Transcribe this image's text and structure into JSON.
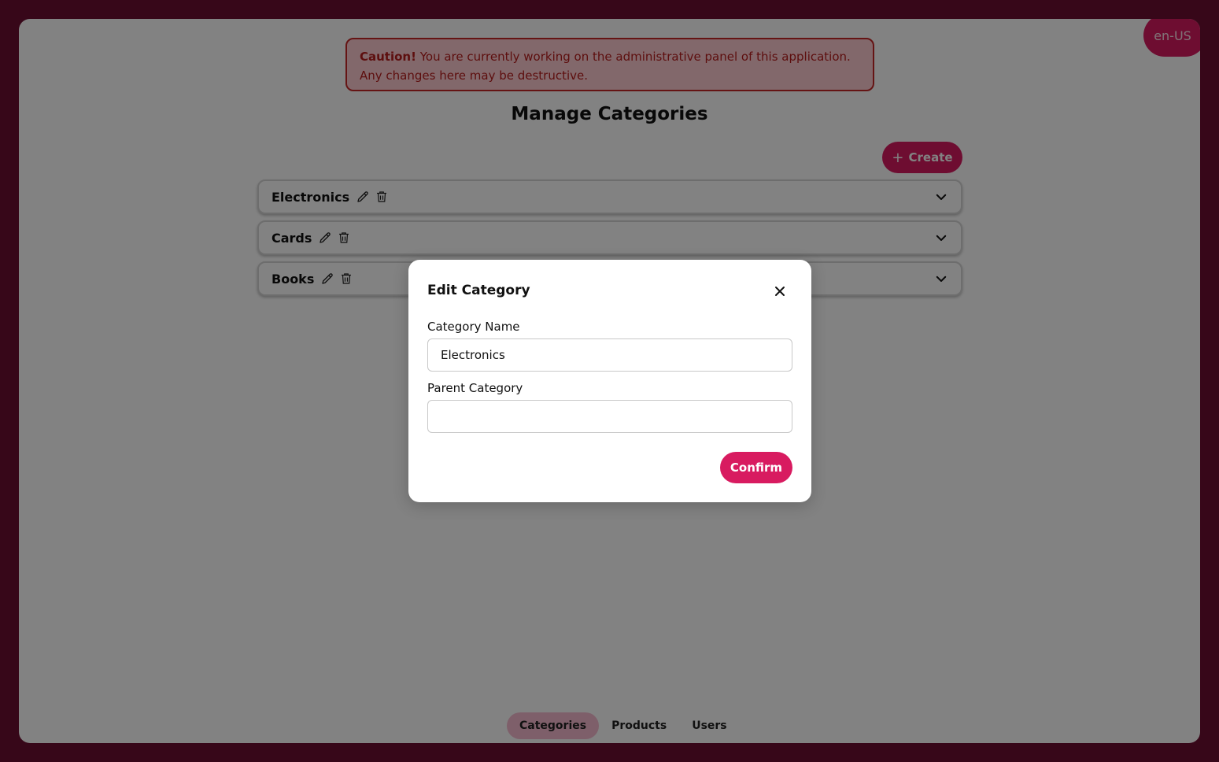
{
  "locale": {
    "label": "en-US"
  },
  "caution": {
    "title": "Caution!",
    "message": " You are currently working on the administrative panel of this application. Any changes here may be destructive."
  },
  "page": {
    "title": "Manage Categories"
  },
  "toolbar": {
    "create_label": "Create",
    "create_icon": "plus-icon"
  },
  "categories": [
    {
      "name": "Electronics"
    },
    {
      "name": "Cards"
    },
    {
      "name": "Books"
    }
  ],
  "nav": {
    "tabs": [
      {
        "label": "Categories",
        "active": true
      },
      {
        "label": "Products",
        "active": false
      },
      {
        "label": "Users",
        "active": false
      }
    ]
  },
  "modal": {
    "title": "Edit Category",
    "category_name_label": "Category Name",
    "category_name_value": "Electronics",
    "parent_category_label": "Parent Category",
    "parent_category_value": "",
    "confirm_label": "Confirm"
  },
  "colors": {
    "accent": "#d81b60",
    "frame": "#6c0e31",
    "caution_bg": "#ffcdd2",
    "caution_text": "#b71c1c",
    "active_tab_bg": "#f8bbd0"
  }
}
